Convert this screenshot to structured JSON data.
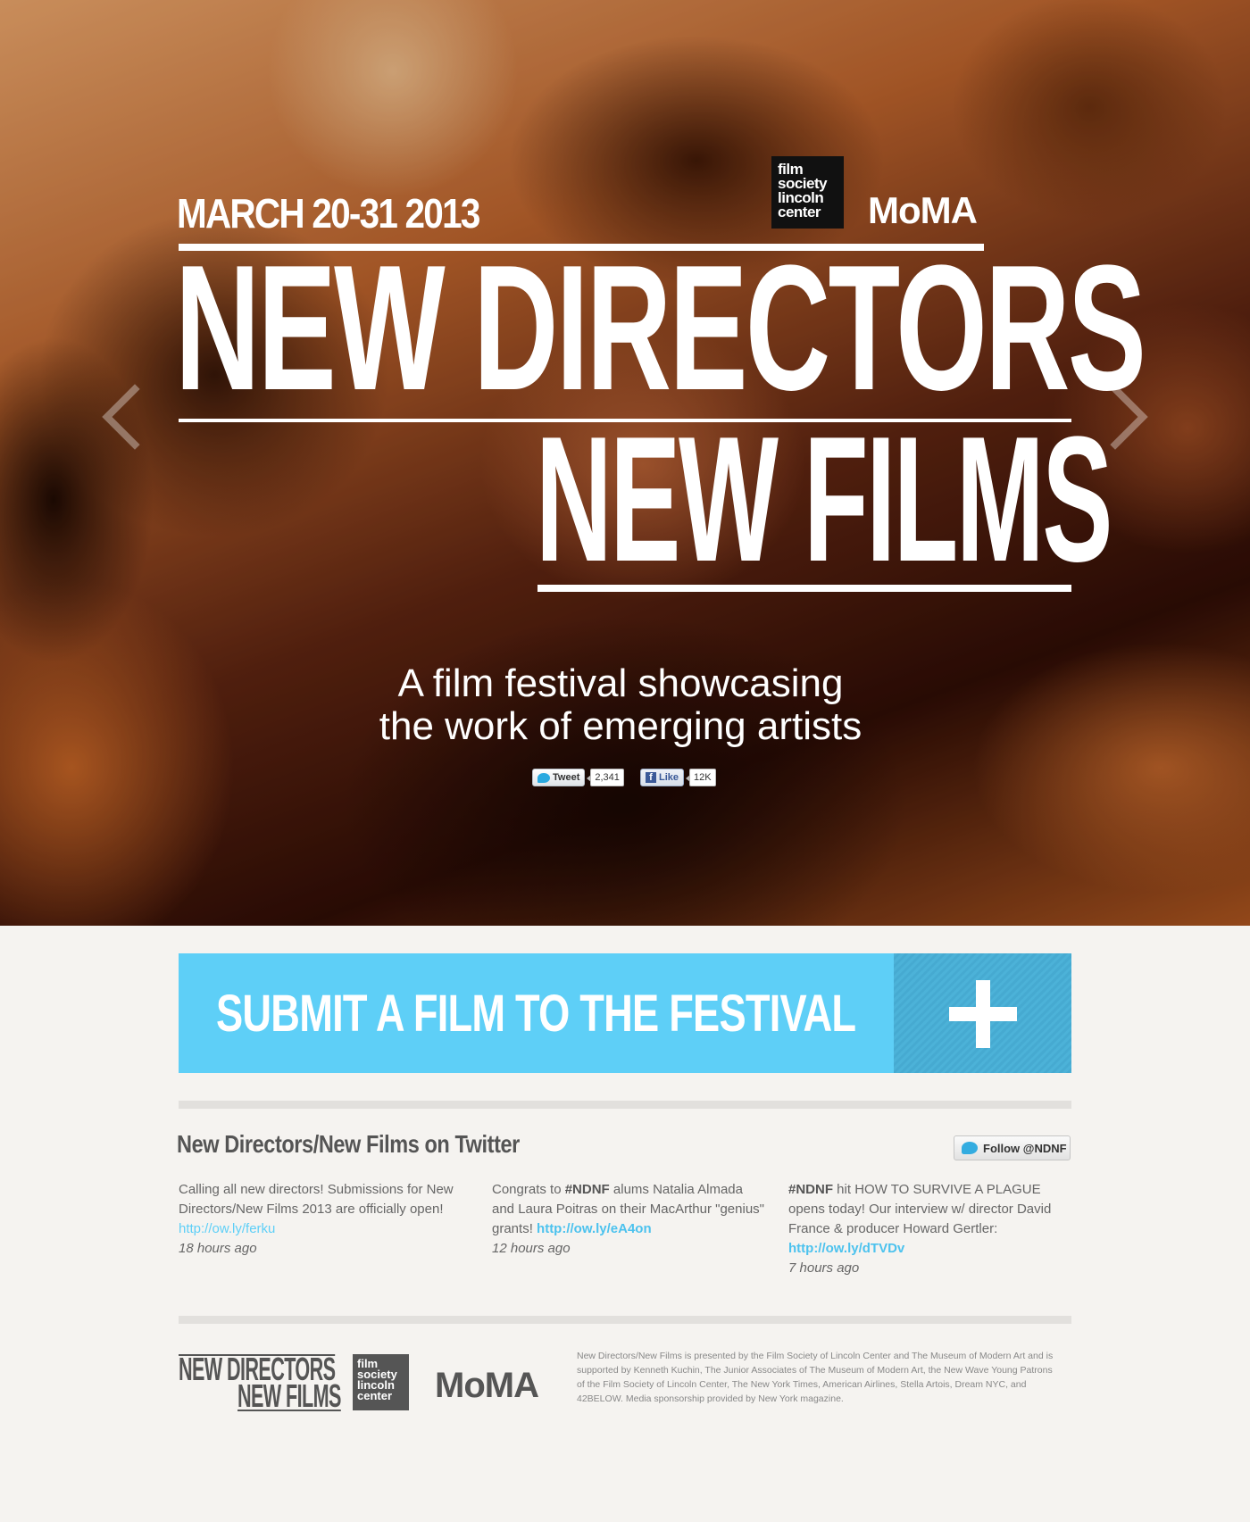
{
  "hero": {
    "date": "MARCH 20-31 2013",
    "fslc_logo": [
      "film",
      "society",
      "lincoln",
      "center"
    ],
    "moma_logo": "MoMA",
    "title_line1": "NEW DIRECTORS",
    "title_line2": "NEW FILMS",
    "tagline_line1": "A film festival showcasing",
    "tagline_line2": "the work of emerging artists",
    "prev_icon": "chevron-left-icon",
    "next_icon": "chevron-right-icon"
  },
  "social": {
    "tweet_label": "Tweet",
    "tweet_count": "2,341",
    "like_label": "Like",
    "like_count": "12K"
  },
  "submit": {
    "label": "SUBMIT A FILM TO THE FESTIVAL",
    "icon": "plus-icon"
  },
  "twitter": {
    "heading": "New Directors/New Films on Twitter",
    "follow_label": "Follow @NDNF",
    "tweets": [
      {
        "text": "Calling all new directors! Submissions for New Directors/New Films 2013 are officially open!",
        "link": "http://ow.ly/ferku",
        "ago": "18 hours ago"
      },
      {
        "pre": "Congrats to ",
        "tag": "#NDNF",
        "text": " alums Natalia Almada and Laura Poitras on their MacArthur \"genius\" grants!",
        "link": "http://ow.ly/eA4on",
        "ago": "12 hours ago"
      },
      {
        "tag": "#NDNF",
        "text": " hit HOW TO SURVIVE A PLAGUE opens today! Our interview w/ director David France & producer Howard Gertler:",
        "link": "http://ow.ly/dTVDv",
        "ago": "7 hours ago"
      }
    ]
  },
  "footer": {
    "ndnf_line1": "NEW DIRECTORS",
    "ndnf_line2": "NEW FILMS",
    "fslc_logo": [
      "film",
      "society",
      "lincoln",
      "center"
    ],
    "moma_logo": "MoMA",
    "credits": "New Directors/New Films is presented by the Film Society of Lincoln Center and The Museum of Modern Art and is supported by Kenneth Kuchin, The Junior Associates of The Museum of Modern Art, the New Wave Young Patrons of the Film Society of Lincoln Center, The New York Times, American Airlines, Stella Artois, Dream NYC, and 42BELOW. Media sponsorship provided by New York magazine."
  }
}
